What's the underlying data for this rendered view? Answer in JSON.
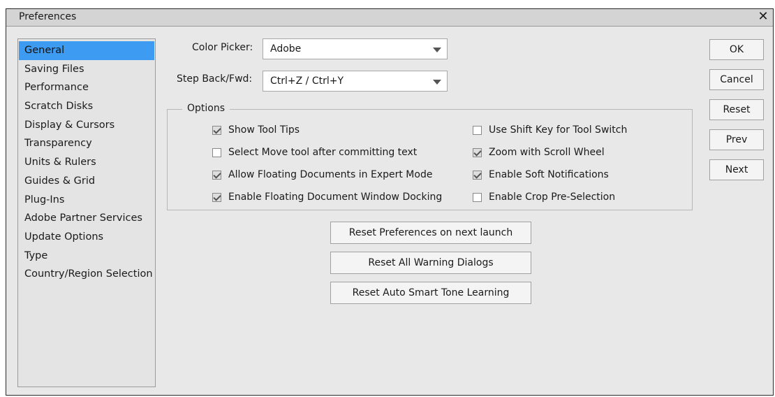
{
  "window": {
    "title": "Preferences",
    "close_glyph": "✕"
  },
  "sidebar": {
    "items": [
      {
        "label": "General",
        "selected": true
      },
      {
        "label": "Saving Files"
      },
      {
        "label": "Performance"
      },
      {
        "label": "Scratch Disks"
      },
      {
        "label": "Display & Cursors"
      },
      {
        "label": "Transparency"
      },
      {
        "label": "Units & Rulers"
      },
      {
        "label": "Guides & Grid"
      },
      {
        "label": "Plug-Ins"
      },
      {
        "label": "Adobe Partner Services"
      },
      {
        "label": "Update Options"
      },
      {
        "label": "Type"
      },
      {
        "label": "Country/Region Selection"
      }
    ]
  },
  "color_picker": {
    "label": "Color Picker:",
    "value": "Adobe"
  },
  "step_back": {
    "label": "Step Back/Fwd:",
    "value": "Ctrl+Z / Ctrl+Y"
  },
  "options": {
    "legend": "Options",
    "show_tool_tips": {
      "label": "Show Tool Tips",
      "checked": true
    },
    "select_move_tool": {
      "label": "Select Move tool after committing text",
      "checked": false
    },
    "allow_floating_docs": {
      "label": "Allow Floating Documents in Expert Mode",
      "checked": true
    },
    "enable_floating_docking": {
      "label": "Enable Floating Document Window Docking",
      "checked": true
    },
    "use_shift_key": {
      "label": "Use Shift Key for Tool Switch",
      "checked": false
    },
    "zoom_scroll_wheel": {
      "label": "Zoom with Scroll Wheel",
      "checked": true
    },
    "enable_soft_notifications": {
      "label": "Enable Soft Notifications",
      "checked": true
    },
    "enable_crop_preselection": {
      "label": "Enable Crop Pre-Selection",
      "checked": false
    }
  },
  "reset_buttons": {
    "reset_prefs": "Reset Preferences on next launch",
    "reset_warnings": "Reset All Warning Dialogs",
    "reset_smart_tone": "Reset Auto Smart Tone Learning"
  },
  "dialog_buttons": {
    "ok": "OK",
    "cancel": "Cancel",
    "reset": "Reset",
    "prev": "Prev",
    "next": "Next"
  }
}
